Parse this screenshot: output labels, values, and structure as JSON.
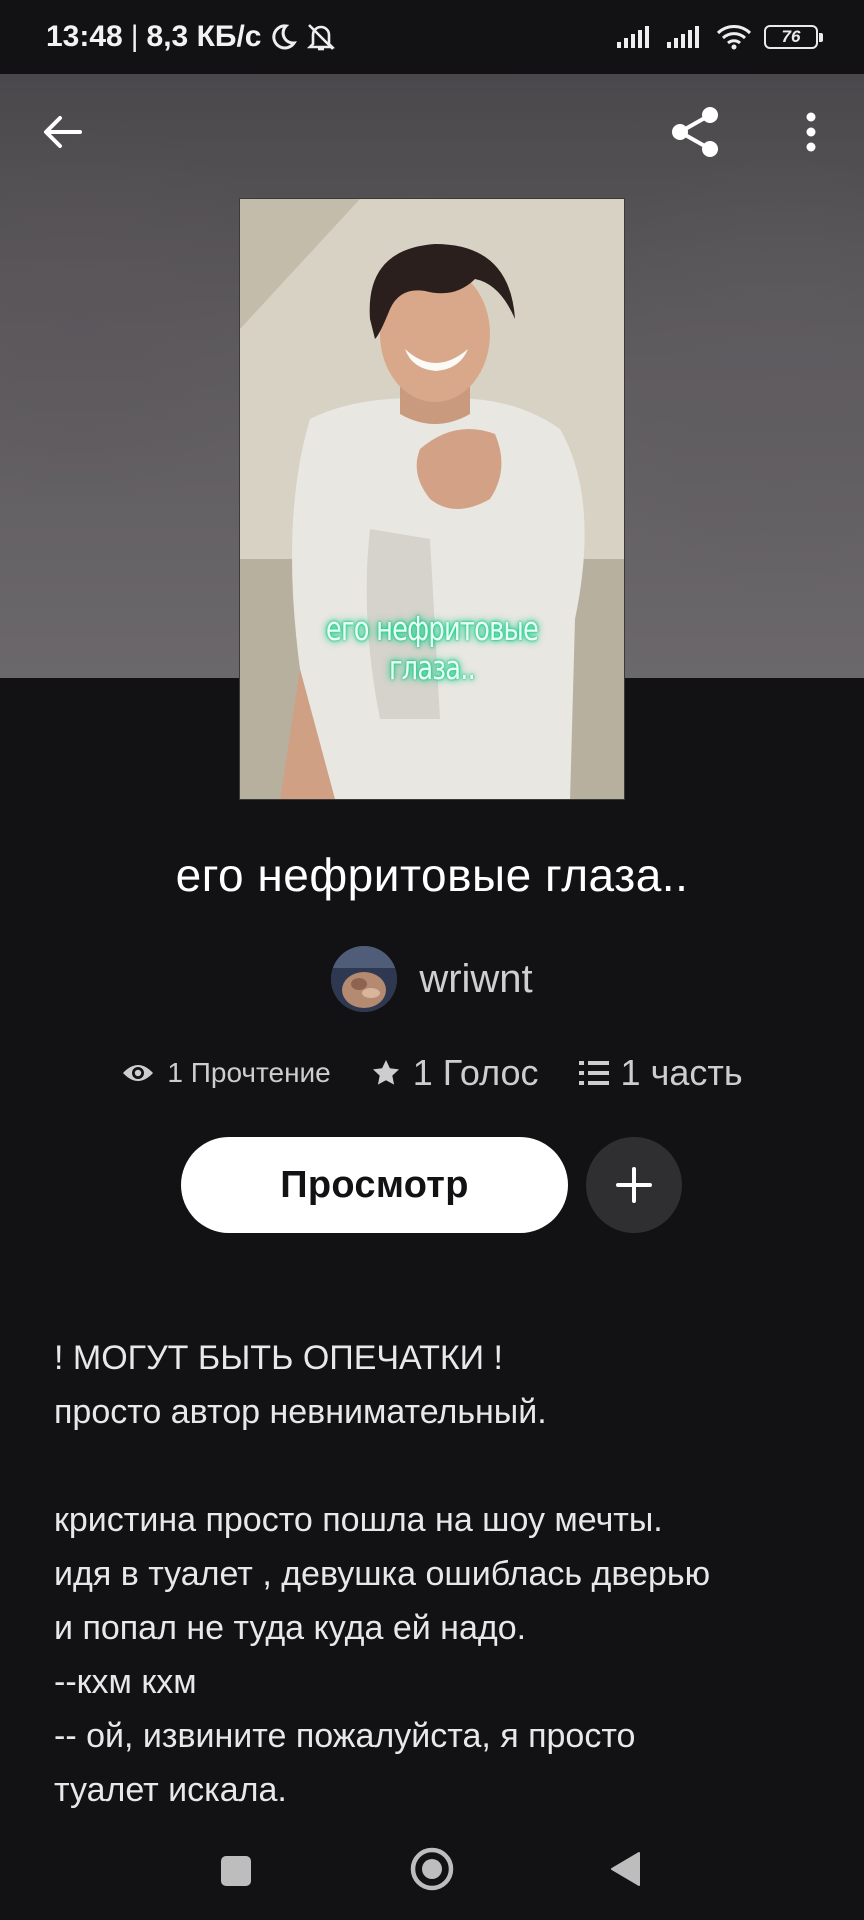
{
  "status_bar": {
    "time": "13:48",
    "separator": "|",
    "speed": "8,3 КБ/с",
    "battery": "76",
    "icons": [
      "moon-icon",
      "bell-off-icon",
      "signal-icon",
      "signal-icon",
      "wifi-icon",
      "battery-icon"
    ]
  },
  "nav": {
    "back_icon": "arrow-left-icon",
    "share_icon": "share-icon",
    "more_icon": "more-vertical-icon"
  },
  "cover": {
    "caption": "его нефритовые глаза.."
  },
  "story": {
    "title": "его нефритовые глаза..",
    "author": "wriwnt",
    "reads": "1 Прочтение",
    "votes": "1 Голос",
    "parts": "1 часть"
  },
  "actions": {
    "view_label": "Просмотр",
    "add_icon": "plus-icon"
  },
  "description": {
    "lines": [
      "! МОГУТ БЫТЬ ОПЕЧАТКИ !",
      "просто автор невнимательный.",
      "",
      "кристина просто пошла на шоу мечты.",
      "идя в туалет , девушка ошиблась дверью",
      "и попал не туда куда ей надо.",
      "--кхм кхм",
      "-- ой, извините пожалуйста, я просто",
      "туалет искала."
    ]
  },
  "system_nav": [
    "recents-square-icon",
    "home-circle-icon",
    "back-triangle-icon"
  ],
  "colors": {
    "background": "#121114",
    "button_primary": "#ffffff",
    "button_secondary": "#2f2e31",
    "caption_glow": "#18e39a"
  }
}
